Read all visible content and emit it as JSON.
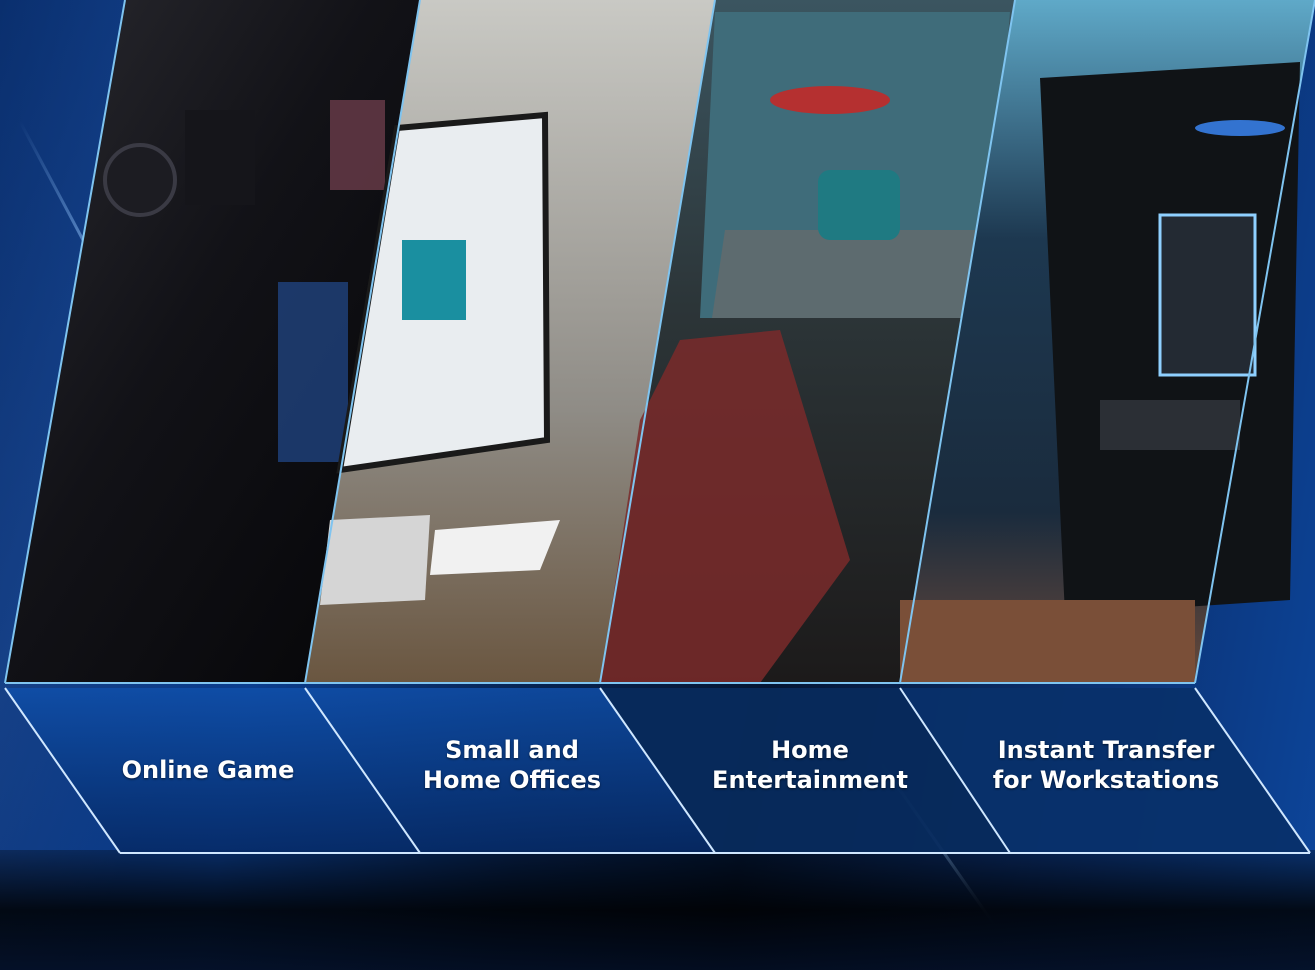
{
  "colors": {
    "background": "#0b3e8f",
    "frame_line": "#7fc4f0",
    "label_text": "#ffffff"
  },
  "panels": [
    {
      "name": "online-game",
      "label_lines": [
        "Online Game"
      ],
      "image": "gamer-with-headset-at-monitors"
    },
    {
      "name": "small-home-offices",
      "label_lines": [
        "Small and",
        "Home Offices"
      ],
      "image": "person-working-at-imac-desk"
    },
    {
      "name": "home-entertainment",
      "label_lines": [
        "Home",
        "Entertainment"
      ],
      "image": "person-playing-racing-game-on-tv"
    },
    {
      "name": "instant-transfer-workstations",
      "label_lines": [
        "Instant Transfer",
        "for Workstations"
      ],
      "image": "pc-case-with-rgb-lighting"
    }
  ]
}
